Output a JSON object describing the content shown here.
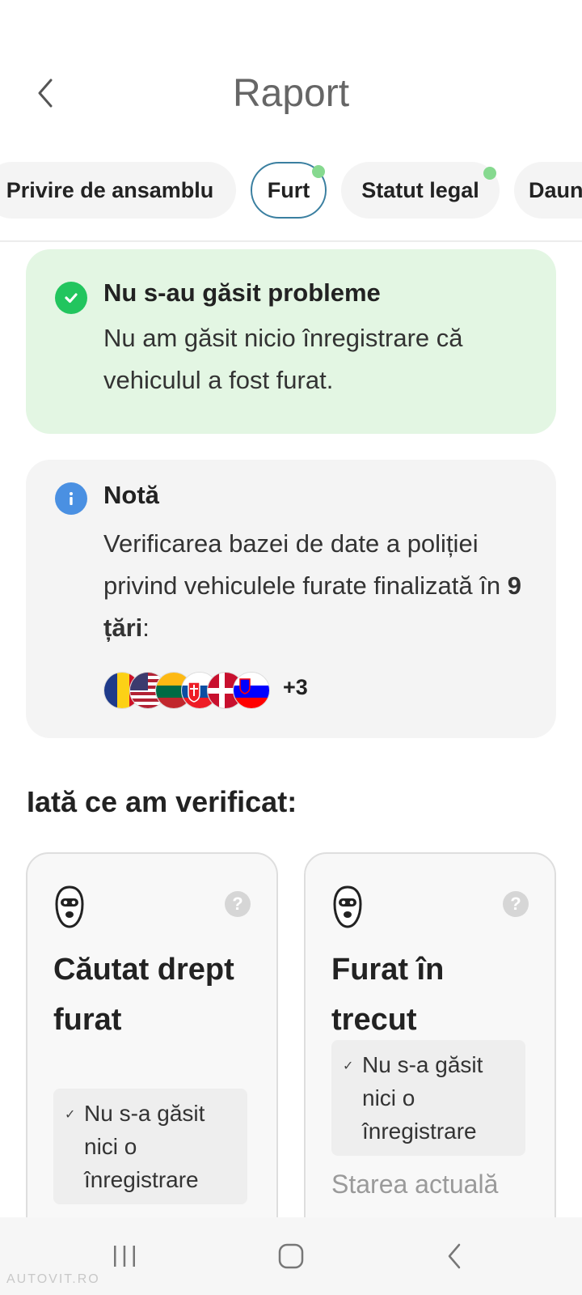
{
  "header": {
    "title": "Raport"
  },
  "tabs": [
    {
      "label": "Privire de ansamblu"
    },
    {
      "label": "Furt"
    },
    {
      "label": "Statut legal"
    },
    {
      "label": "Daun"
    }
  ],
  "result_card": {
    "title": "Nu s-au găsit probleme",
    "body": "Nu am găsit nicio înregistrare că vehiculul a fost furat."
  },
  "note_card": {
    "title": "Notă",
    "body_prefix": "Verificarea bazei de date a poliției privind vehiculele furate finalizată în ",
    "body_bold": "9 țări",
    "body_suffix": ":",
    "flags": [
      "romania",
      "usa",
      "lithuania",
      "slovakia",
      "denmark",
      "slovenia"
    ],
    "flags_more": "+3"
  },
  "section": {
    "title": "Iată ce am verificat:"
  },
  "checks": [
    {
      "icon": "balaclava-icon",
      "help": "?",
      "title": "Căutat drept furat",
      "status": "Nu s-a găsit nici o înregistrare"
    },
    {
      "icon": "balaclava-icon",
      "help": "?",
      "title": "Furat în trecut",
      "status": "Nu s-a găsit nici o înregistrare",
      "subtitle": "Starea actuală"
    }
  ],
  "watermark": "AUTOVIT.RO",
  "colors": {
    "success_bg": "#e3f6e3",
    "success_icon": "#22c55e",
    "info_icon": "#4a90e2",
    "active_tab_border": "#3a7fa0",
    "tab_dot": "#86d98f"
  }
}
